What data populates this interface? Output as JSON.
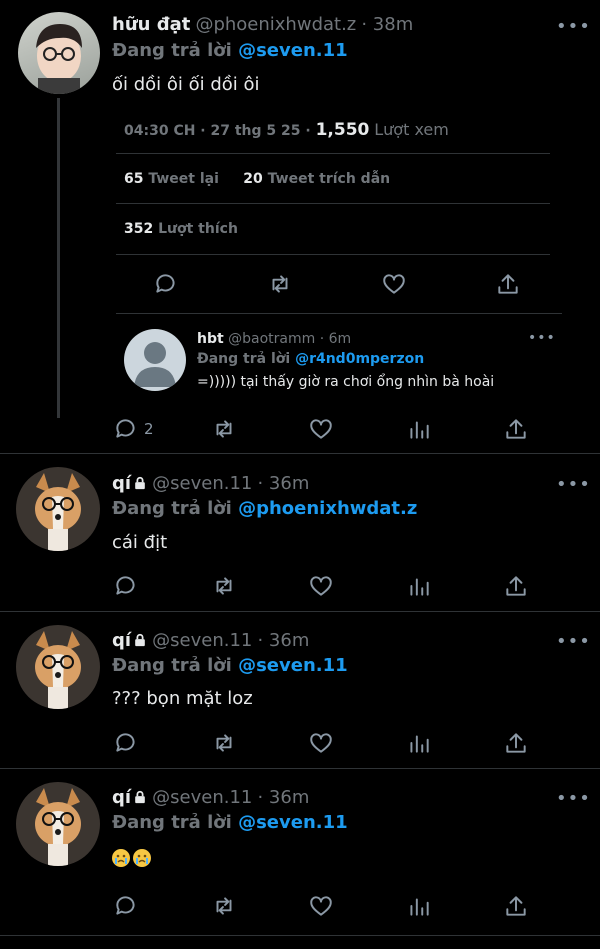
{
  "main_tweet": {
    "name": "hữu đạt",
    "handle": "@phoenixhwdat.z",
    "time": "· 38m",
    "reply_prefix": "Đang trả lời",
    "reply_to": "@seven.11",
    "text": "ối dồi ôi ối dồi ôi",
    "meta": "04:30 CH · 27 thg 5 25 ·",
    "views_count": "1,550",
    "views_label": "Lượt xem",
    "retweets_count": "65",
    "retweets_label": "Tweet lại",
    "quotes_count": "20",
    "quotes_label": "Tweet trích dẫn",
    "likes_count": "352",
    "likes_label": "Lượt thích"
  },
  "nested_reply": {
    "name": "hbt",
    "handle": "@baotramm",
    "time": "· 6m",
    "reply_prefix": "Đang trả lời",
    "reply_to": "@r4nd0mperzon",
    "text": "=))))) tại thấy giờ ra chơi ổng nhìn bà hoài",
    "reply_count": "2"
  },
  "replies": [
    {
      "name": "qí",
      "handle": "@seven.11",
      "time": "· 36m",
      "reply_prefix": "Đang trả lời",
      "reply_to": "@phoenixhwdat.z",
      "text": "cái địt"
    },
    {
      "name": "qí",
      "handle": "@seven.11",
      "time": "· 36m",
      "reply_prefix": "Đang trả lời",
      "reply_to": "@seven.11",
      "text": "??? bọn mặt loz"
    },
    {
      "name": "qí",
      "handle": "@seven.11",
      "time": "· 36m",
      "reply_prefix": "Đang trả lời",
      "reply_to": "@seven.11",
      "text": ""
    }
  ],
  "more_label": "•••",
  "icons": [
    "reply-icon",
    "retweet-icon",
    "like-icon",
    "share-icon",
    "analytics-icon",
    "lock-icon",
    "crying-emoji"
  ],
  "colors": {
    "background": "#000000",
    "link": "#1d9bf0",
    "muted": "#71767b",
    "separator": "#2f3336"
  }
}
